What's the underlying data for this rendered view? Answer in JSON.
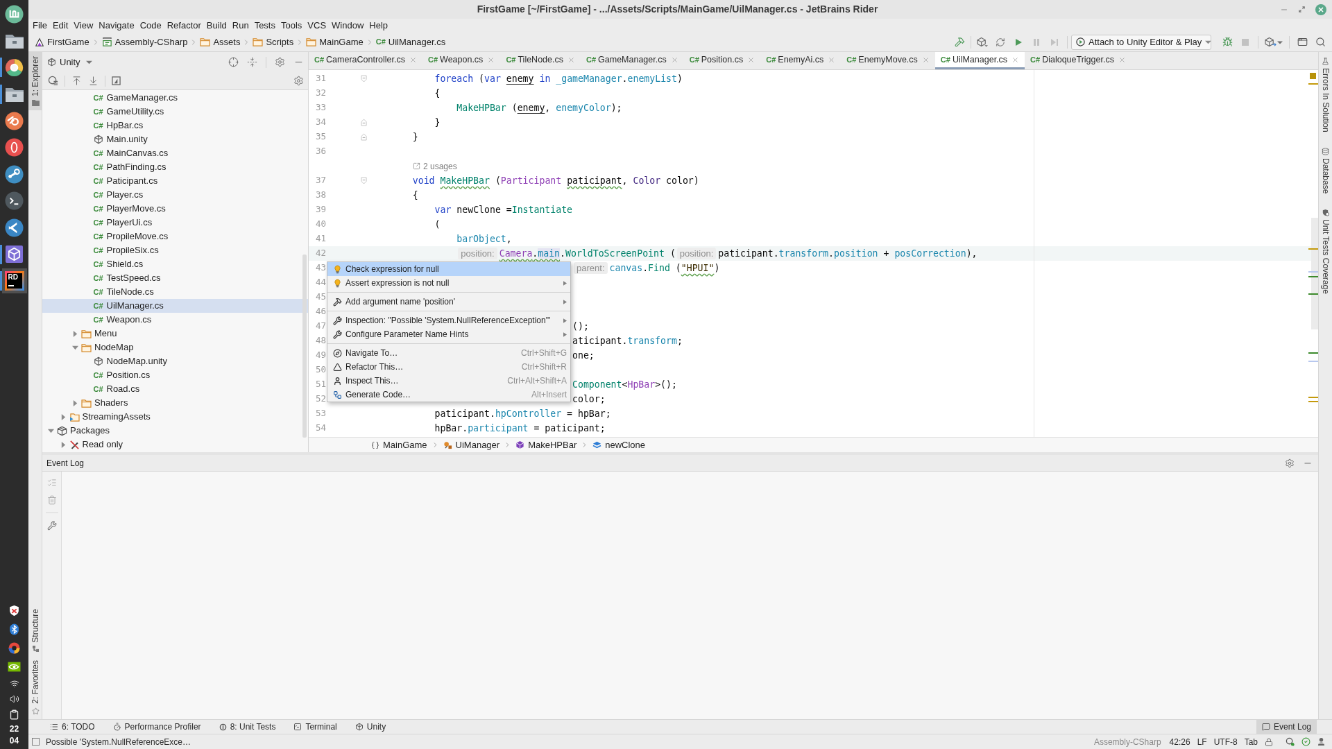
{
  "dock": {
    "apps": [
      {
        "kind": "menu",
        "running": false,
        "active": false
      },
      {
        "kind": "files",
        "running": false,
        "active": false
      },
      {
        "kind": "browser",
        "running": true,
        "active": false
      },
      {
        "kind": "files",
        "running": true,
        "active": false
      },
      {
        "kind": "modeler",
        "running": false,
        "active": false
      },
      {
        "kind": "web",
        "running": false,
        "active": false
      },
      {
        "kind": "games",
        "running": false,
        "active": false
      },
      {
        "kind": "terminal",
        "running": false,
        "active": false
      },
      {
        "kind": "code",
        "running": false,
        "active": false
      },
      {
        "kind": "engine",
        "running": true,
        "active": false
      },
      {
        "kind": "ide",
        "label": "RD",
        "running": true,
        "active": true
      }
    ],
    "tray": [
      {
        "kind": "shield"
      },
      {
        "kind": "bluetooth"
      },
      {
        "kind": "chat"
      },
      {
        "kind": "gpu"
      },
      {
        "kind": "wifi"
      },
      {
        "kind": "volume"
      },
      {
        "kind": "battery"
      }
    ],
    "clock": {
      "hours": "22",
      "minutes": "04"
    }
  },
  "window": {
    "title": "FirstGame [~/FirstGame] - .../Assets/Scripts/MainGame/UilManager.cs - JetBrains Rider"
  },
  "menu": [
    "File",
    "Edit",
    "View",
    "Navigate",
    "Code",
    "Refactor",
    "Build",
    "Run",
    "Tests",
    "Tools",
    "VCS",
    "Window",
    "Help"
  ],
  "navigation": {
    "path": [
      {
        "kind": "solution",
        "label": "FirstGame"
      },
      {
        "kind": "project",
        "label": "Assembly-CSharp"
      },
      {
        "kind": "folder",
        "label": "Assets"
      },
      {
        "kind": "folder",
        "label": "Scripts"
      },
      {
        "kind": "folder",
        "label": "MainGame"
      },
      {
        "kind": "file",
        "type_label": "C#",
        "label": "UilManager.cs"
      }
    ],
    "toolbar": [
      {
        "kind": "build",
        "disabled": false
      },
      {
        "kind": "attach",
        "disabled": false
      },
      {
        "kind": "refresh",
        "disabled": false
      },
      {
        "kind": "run",
        "disabled": false
      },
      {
        "kind": "pause",
        "disabled": true
      },
      {
        "kind": "step",
        "disabled": true
      }
    ],
    "run_config": {
      "label": "Attach to Unity Editor & Play"
    },
    "debug_tools": [
      {
        "kind": "debug",
        "disabled": false
      },
      {
        "kind": "stop",
        "disabled": true
      }
    ]
  },
  "left_strip": [
    {
      "kind": "explorer",
      "label": "1: Explorer",
      "selected": true
    },
    {
      "kind": "structure",
      "label": "Structure",
      "selected": false
    },
    {
      "kind": "favorites",
      "label": "2: Favorites",
      "selected": false
    }
  ],
  "explorer": {
    "title": "Unity",
    "tree": [
      {
        "children": [
          {
            "children": [
              {
                "children": [
                  {
                    "kind": "script",
                    "type_label": "C#",
                    "label": "GameManager.cs",
                    "selected": false
                  },
                  {
                    "kind": "script",
                    "type_label": "C#",
                    "label": "GameUtility.cs",
                    "selected": false
                  },
                  {
                    "kind": "script",
                    "type_label": "C#",
                    "label": "HpBar.cs",
                    "selected": false
                  },
                  {
                    "kind": "scene",
                    "label": "Main.unity",
                    "selected": false
                  },
                  {
                    "kind": "script",
                    "type_label": "C#",
                    "label": "MainCanvas.cs",
                    "selected": false
                  },
                  {
                    "kind": "script",
                    "type_label": "C#",
                    "label": "PathFinding.cs",
                    "selected": false
                  },
                  {
                    "kind": "script",
                    "type_label": "C#",
                    "label": "Paticipant.cs",
                    "selected": false
                  },
                  {
                    "kind": "script",
                    "type_label": "C#",
                    "label": "Player.cs",
                    "selected": false
                  },
                  {
                    "kind": "script",
                    "type_label": "C#",
                    "label": "PlayerMove.cs",
                    "selected": false
                  },
                  {
                    "kind": "script",
                    "type_label": "C#",
                    "label": "PlayerUi.cs",
                    "selected": false
                  },
                  {
                    "kind": "script",
                    "type_label": "C#",
                    "label": "PropileMove.cs",
                    "selected": false
                  },
                  {
                    "kind": "script",
                    "type_label": "C#",
                    "label": "PropileSix.cs",
                    "selected": false
                  },
                  {
                    "kind": "script",
                    "type_label": "C#",
                    "label": "Shield.cs",
                    "selected": false
                  },
                  {
                    "kind": "script",
                    "type_label": "C#",
                    "label": "TestSpeed.cs",
                    "selected": false
                  },
                  {
                    "kind": "script",
                    "type_label": "C#",
                    "label": "TileNode.cs",
                    "selected": false
                  },
                  {
                    "kind": "script",
                    "type_label": "C#",
                    "label": "UilManager.cs",
                    "selected": true
                  },
                  {
                    "kind": "script",
                    "type_label": "C#",
                    "label": "Weapon.cs",
                    "selected": false
                  }
                ]
              },
              {
                "kind": "folder",
                "label": "Menu",
                "expanded": false,
                "selected": false
              },
              {
                "kind": "folder",
                "label": "NodeMap",
                "expanded": true,
                "selected": false,
                "children": [
                  {
                    "kind": "scene",
                    "label": "NodeMap.unity",
                    "selected": false
                  },
                  {
                    "kind": "script",
                    "type_label": "C#",
                    "label": "Position.cs",
                    "selected": false
                  },
                  {
                    "kind": "script",
                    "type_label": "C#",
                    "label": "Road.cs",
                    "selected": false
                  }
                ]
              },
              {
                "kind": "folder",
                "label": "Shaders",
                "expanded": false,
                "selected": false
              }
            ]
          },
          {
            "kind": "resources",
            "label": "StreamingAssets",
            "expanded": false,
            "selected": false
          }
        ]
      },
      {
        "kind": "packages",
        "label": "Packages",
        "expanded": true,
        "selected": false,
        "children": [
          {
            "kind": "readonly",
            "label": "Read only",
            "expanded": false,
            "selected": false
          }
        ]
      }
    ]
  },
  "editor": {
    "tabs": [
      {
        "type_label": "C#",
        "label": "CameraController.cs",
        "selected": false
      },
      {
        "type_label": "C#",
        "label": "Weapon.cs",
        "selected": false
      },
      {
        "type_label": "C#",
        "label": "TileNode.cs",
        "selected": false
      },
      {
        "type_label": "C#",
        "label": "GameManager.cs",
        "selected": false
      },
      {
        "type_label": "C#",
        "label": "Position.cs",
        "selected": false
      },
      {
        "type_label": "C#",
        "label": "EnemyAi.cs",
        "selected": false
      },
      {
        "type_label": "C#",
        "label": "EnemyMove.cs",
        "selected": false
      },
      {
        "type_label": "C#",
        "label": "UilManager.cs",
        "selected": true
      },
      {
        "type_label": "C#",
        "label": "DialoqueTrigger.cs",
        "selected": false
      }
    ],
    "lines": [
      {
        "kind": "block-start",
        "number": "31",
        "current": false,
        "tokens": [
          {
            "text": "        foreach",
            "kind": "keyword"
          },
          {
            "text": " (",
            "kind": "plain"
          },
          {
            "text": "var",
            "kind": "keyword"
          },
          {
            "text": " enemy",
            "kind": "plain",
            "underlined": true
          },
          {
            "text": " in",
            "kind": "keyword"
          },
          {
            "text": " _gameManager",
            "kind": "field"
          },
          {
            "text": ".",
            "kind": "plain"
          },
          {
            "text": "enemyList",
            "kind": "field"
          },
          {
            "text": ")",
            "kind": "plain"
          }
        ]
      },
      {
        "kind": "code",
        "number": "32",
        "current": false,
        "tokens": [
          {
            "text": "        {",
            "kind": "plain"
          }
        ]
      },
      {
        "kind": "code",
        "number": "33",
        "current": false,
        "tokens": [
          {
            "text": "            MakeHPBar",
            "kind": "method"
          },
          {
            "text": " (",
            "kind": "plain"
          },
          {
            "text": "enemy",
            "kind": "plain",
            "underlined": true
          },
          {
            "text": ", ",
            "kind": "plain"
          },
          {
            "text": "enemyColor",
            "kind": "field"
          },
          {
            "text": ");",
            "kind": "plain"
          }
        ]
      },
      {
        "kind": "block-end",
        "number": "34",
        "current": false,
        "tokens": [
          {
            "text": "        }",
            "kind": "plain"
          }
        ]
      },
      {
        "kind": "block-end",
        "number": "35",
        "current": false,
        "tokens": [
          {
            "text": "    }",
            "kind": "plain"
          }
        ]
      },
      {
        "kind": "code",
        "number": "36",
        "current": false
      },
      {
        "kind": "usages",
        "text": "2 usages"
      },
      {
        "kind": "block-start",
        "number": "37",
        "current": false,
        "tokens": [
          {
            "text": "    void",
            "kind": "keyword"
          },
          {
            "text": " MakeHPBar",
            "kind": "method",
            "squiggly": true
          },
          {
            "text": " (",
            "kind": "plain"
          },
          {
            "text": "Participant",
            "kind": "class"
          },
          {
            "text": " paticipant",
            "kind": "plain",
            "squiggly": true
          },
          {
            "text": ", ",
            "kind": "plain"
          },
          {
            "text": "Color",
            "kind": "struct"
          },
          {
            "text": " color)",
            "kind": "plain"
          }
        ]
      },
      {
        "kind": "code",
        "number": "38",
        "current": false,
        "tokens": [
          {
            "text": "    {",
            "kind": "plain"
          }
        ]
      },
      {
        "kind": "code",
        "number": "39",
        "current": false,
        "tokens": [
          {
            "text": "        var",
            "kind": "keyword"
          },
          {
            "text": " newClone =",
            "kind": "plain"
          },
          {
            "text": "Instantiate",
            "kind": "method"
          }
        ]
      },
      {
        "kind": "code",
        "number": "40",
        "current": false,
        "tokens": [
          {
            "text": "        (",
            "kind": "plain"
          }
        ]
      },
      {
        "kind": "code",
        "number": "41",
        "current": false,
        "tokens": [
          {
            "text": "            barObject",
            "kind": "field"
          },
          {
            "text": ",",
            "kind": "plain"
          }
        ]
      },
      {
        "kind": "code",
        "number": "42",
        "current": true,
        "tokens": [
          {
            "text": "            position:",
            "kind": "hint"
          },
          {
            "text": "Camera",
            "kind": "class",
            "squiggly": true
          },
          {
            "text": ".",
            "kind": "plain",
            "squiggly": true
          },
          {
            "text": "main",
            "kind": "field",
            "squiggly": true,
            "highlighted": true
          },
          {
            "text": ".",
            "kind": "plain"
          },
          {
            "text": "WorldToScreenPoint",
            "kind": "method"
          },
          {
            "text": " (",
            "kind": "plain"
          },
          {
            "text": "position:",
            "kind": "hint"
          },
          {
            "text": "paticipant.",
            "kind": "plain"
          },
          {
            "text": "transform",
            "kind": "field"
          },
          {
            "text": ".",
            "kind": "plain"
          },
          {
            "text": "position",
            "kind": "field"
          },
          {
            "text": " + ",
            "kind": "plain"
          },
          {
            "text": "posCorrection",
            "kind": "field"
          },
          {
            "text": "),",
            "kind": "plain"
          }
        ]
      },
      {
        "kind": "code",
        "number": "43",
        "current": false,
        "tokens": [
          {
            "text": "                                 parent:",
            "kind": "hint"
          },
          {
            "text": "canvas",
            "kind": "field"
          },
          {
            "text": ".",
            "kind": "plain"
          },
          {
            "text": "Find",
            "kind": "method"
          },
          {
            "text": " (",
            "kind": "plain"
          },
          {
            "text": "\"HPUI\"",
            "kind": "string",
            "squiggly": true
          },
          {
            "text": ")",
            "kind": "plain"
          }
        ]
      },
      {
        "kind": "code",
        "number": "44",
        "current": false
      },
      {
        "kind": "code",
        "number": "45",
        "current": false
      },
      {
        "kind": "code",
        "number": "46",
        "current": false
      },
      {
        "kind": "code",
        "number": "47",
        "current": false,
        "tokens": [
          {
            "text": "                                 ();",
            "kind": "plain"
          }
        ]
      },
      {
        "kind": "code",
        "number": "48",
        "current": false,
        "tokens": [
          {
            "text": "                                 aticipant.",
            "kind": "plain"
          },
          {
            "text": "transform",
            "kind": "field"
          },
          {
            "text": ";",
            "kind": "plain"
          }
        ]
      },
      {
        "kind": "code",
        "number": "49",
        "current": false,
        "tokens": [
          {
            "text": "                                 one;",
            "kind": "plain"
          }
        ]
      },
      {
        "kind": "code",
        "number": "50",
        "current": false
      },
      {
        "kind": "code",
        "number": "51",
        "current": false,
        "tokens": [
          {
            "text": "                                 Component",
            "kind": "method"
          },
          {
            "text": "<",
            "kind": "plain"
          },
          {
            "text": "HpBar",
            "kind": "class"
          },
          {
            "text": ">();",
            "kind": "plain"
          }
        ]
      },
      {
        "kind": "code",
        "number": "52",
        "current": false,
        "tokens": [
          {
            "text": "                                 color;",
            "kind": "plain"
          }
        ]
      },
      {
        "kind": "code",
        "number": "53",
        "current": false,
        "tokens": [
          {
            "text": "        paticipant.",
            "kind": "plain"
          },
          {
            "text": "hpController",
            "kind": "field"
          },
          {
            "text": " = hpBar;",
            "kind": "plain"
          }
        ]
      },
      {
        "kind": "code",
        "number": "54",
        "current": false,
        "tokens": [
          {
            "text": "        hpBar.",
            "kind": "plain"
          },
          {
            "text": "participant",
            "kind": "field"
          },
          {
            "text": " = paticipant;",
            "kind": "plain"
          }
        ]
      }
    ],
    "context_menu": {
      "groups": [
        [
          {
            "kind": "fix",
            "label": "Check expression for null",
            "submenu": false,
            "selected": true
          },
          {
            "kind": "fix",
            "label": "Assert expression is not null",
            "submenu": true,
            "selected": false
          }
        ],
        [
          {
            "kind": "action",
            "label": "Add argument name 'position'",
            "submenu": true,
            "selected": false
          }
        ],
        [
          {
            "kind": "option",
            "label": "Inspection: \"Possible 'System.NullReferenceException'\"",
            "submenu": true,
            "selected": false
          },
          {
            "kind": "option",
            "label": "Configure Parameter Name Hints",
            "submenu": true,
            "selected": false
          }
        ],
        [
          {
            "kind": "navigate",
            "label": "Navigate To…",
            "shortcut": "Ctrl+Shift+G",
            "submenu": false,
            "selected": false
          },
          {
            "kind": "refactor",
            "label": "Refactor This…",
            "shortcut": "Ctrl+Shift+R",
            "submenu": false,
            "selected": false
          },
          {
            "kind": "inspect",
            "label": "Inspect This…",
            "shortcut": "Ctrl+Alt+Shift+A",
            "submenu": false,
            "selected": false
          },
          {
            "kind": "generate",
            "label": "Generate Code…",
            "shortcut": "Alt+Insert",
            "submenu": false,
            "selected": false
          }
        ]
      ]
    },
    "breadcrumb": [
      {
        "kind": "namespace",
        "label": "MainGame"
      },
      {
        "kind": "class",
        "label": "UiManager"
      },
      {
        "kind": "method",
        "label": "MakeHPBar"
      },
      {
        "kind": "variable",
        "label": "newClone"
      }
    ]
  },
  "right_strip": [
    {
      "kind": "errors",
      "label": "Errors In Solution"
    },
    {
      "kind": "database",
      "label": "Database"
    },
    {
      "kind": "coverage",
      "label": "Unit Tests Coverage"
    }
  ],
  "event_log": {
    "title": "Event Log"
  },
  "tool_windows": [
    {
      "kind": "todo",
      "label": "6: TODO",
      "selected": false
    },
    {
      "kind": "profiler",
      "label": "Performance Profiler",
      "selected": false
    },
    {
      "kind": "tests",
      "label": "8: Unit Tests",
      "selected": false
    },
    {
      "kind": "terminal",
      "label": "Terminal",
      "selected": false
    },
    {
      "kind": "unity",
      "label": "Unity",
      "selected": false
    },
    {
      "kind": "log",
      "label": "Event Log",
      "selected": true
    }
  ],
  "status_bar": {
    "message": "Possible 'System.NullReferenceExce…",
    "project": "Assembly-CSharp",
    "position": "42:26",
    "line_ending": "LF",
    "encoding": "UTF-8",
    "indent": "Tab"
  }
}
